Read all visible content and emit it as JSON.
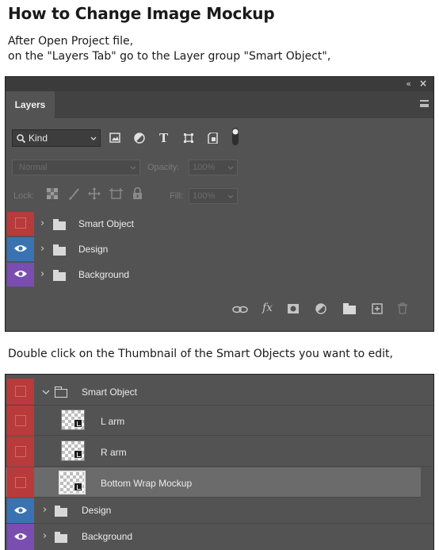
{
  "page": {
    "title": "How to Change Image Mockup",
    "intro_line1": "After Open Project file,",
    "intro_line2": "on the \"Layers Tab\" go to the Layer group \"Smart Object\",",
    "instruction2": "Double click on the Thumbnail of the Smart Objects you want to edit,"
  },
  "panel": {
    "collapse_glyph": "«",
    "close_glyph": "×",
    "tab_label": "Layers",
    "filter": {
      "label": "Kind",
      "icons": [
        "image-filter-icon",
        "adjustment-filter-icon",
        "type-filter-icon",
        "shape-filter-icon",
        "smart-object-filter-icon",
        "filter-toggle-icon"
      ]
    },
    "blend_mode": "Normal",
    "opacity_label": "Opacity:",
    "opacity_value": "100%",
    "lock_label": "Lock:",
    "fill_label": "Fill:",
    "fill_value": "100%",
    "layers": [
      {
        "name": "Smart Object",
        "visibility": "hidden",
        "color": "#b83a3a"
      },
      {
        "name": "Design",
        "visibility": "visible",
        "color": "#3a73b1"
      },
      {
        "name": "Background",
        "visibility": "visible",
        "color": "#7a4db1"
      }
    ],
    "bottom_icons": [
      "link-icon",
      "fx-icon",
      "mask-icon",
      "adjustment-icon",
      "new-group-icon",
      "new-layer-icon",
      "trash-icon"
    ],
    "fx_text": "fx"
  },
  "panel2": {
    "group": {
      "name": "Smart Object",
      "color": "#b83a3a"
    },
    "children": [
      {
        "name": "L arm",
        "selected": false
      },
      {
        "name": "R arm",
        "selected": false
      },
      {
        "name": "Bottom Wrap Mockup",
        "selected": true
      }
    ],
    "layers": [
      {
        "name": "Design",
        "color": "#3a73b1"
      },
      {
        "name": "Background",
        "color": "#7a4db1"
      }
    ]
  }
}
